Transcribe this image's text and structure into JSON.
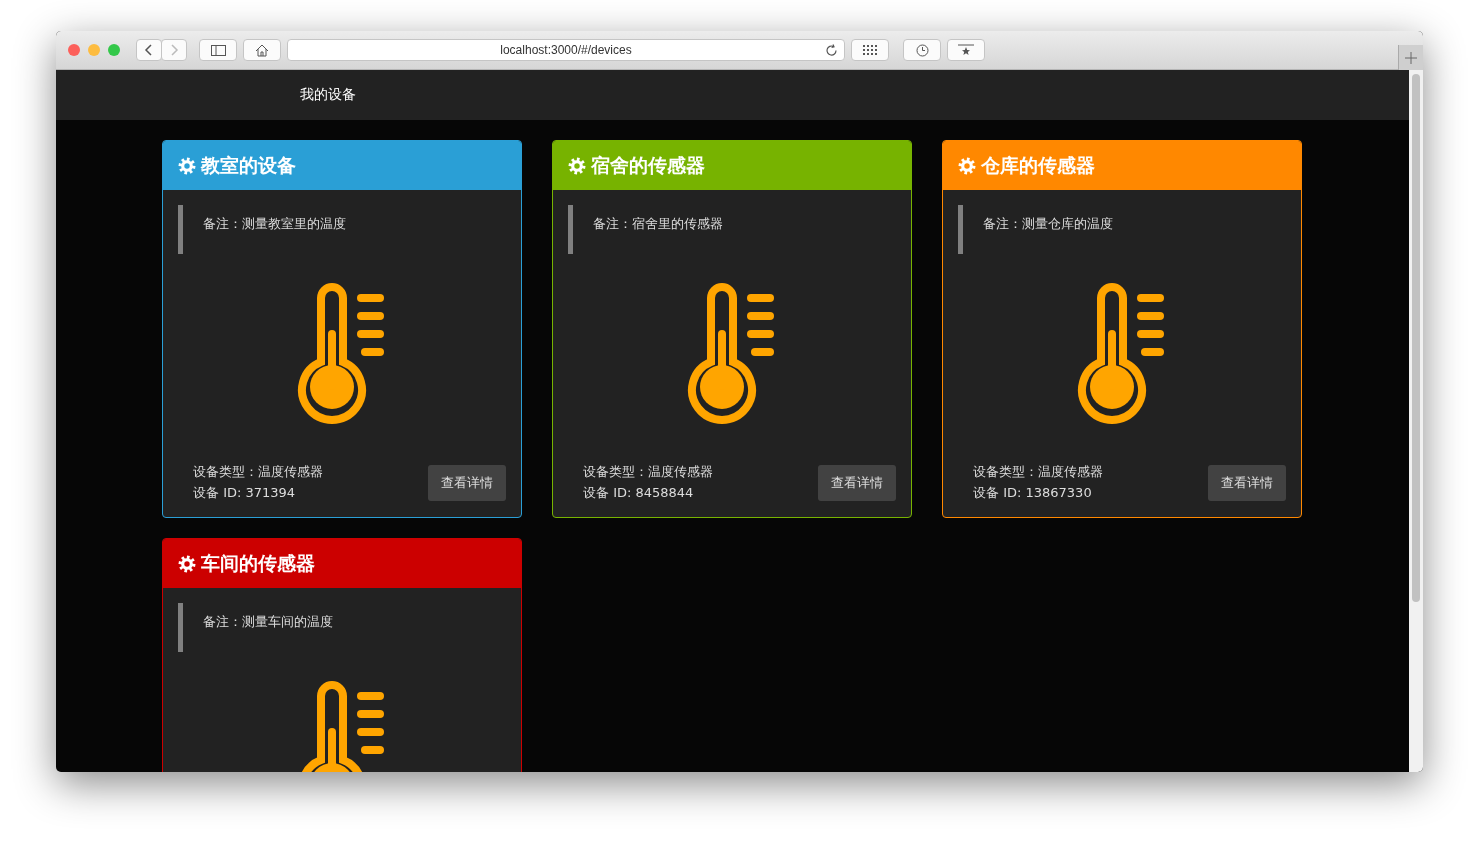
{
  "browser": {
    "url": "localhost:3000/#/devices"
  },
  "nav": {
    "title": "我的设备"
  },
  "cards": [
    {
      "color": "#2a9fd6",
      "title": "教室的设备",
      "note": "备注：测量教室里的温度",
      "type": "设备类型：温度传感器",
      "device_id": "设备 ID: 371394",
      "button": "查看详情"
    },
    {
      "color": "#77b300",
      "title": "宿舍的传感器",
      "note": "备注：宿舍里的传感器",
      "type": "设备类型：温度传感器",
      "device_id": "设备 ID: 8458844",
      "button": "查看详情"
    },
    {
      "color": "#ff8800",
      "title": "仓库的传感器",
      "note": "备注：测量仓库的温度",
      "type": "设备类型：温度传感器",
      "device_id": "设备 ID: 13867330",
      "button": "查看详情"
    },
    {
      "color": "#cc0000",
      "title": "车间的传感器",
      "note": "备注：测量车间的温度"
    }
  ]
}
